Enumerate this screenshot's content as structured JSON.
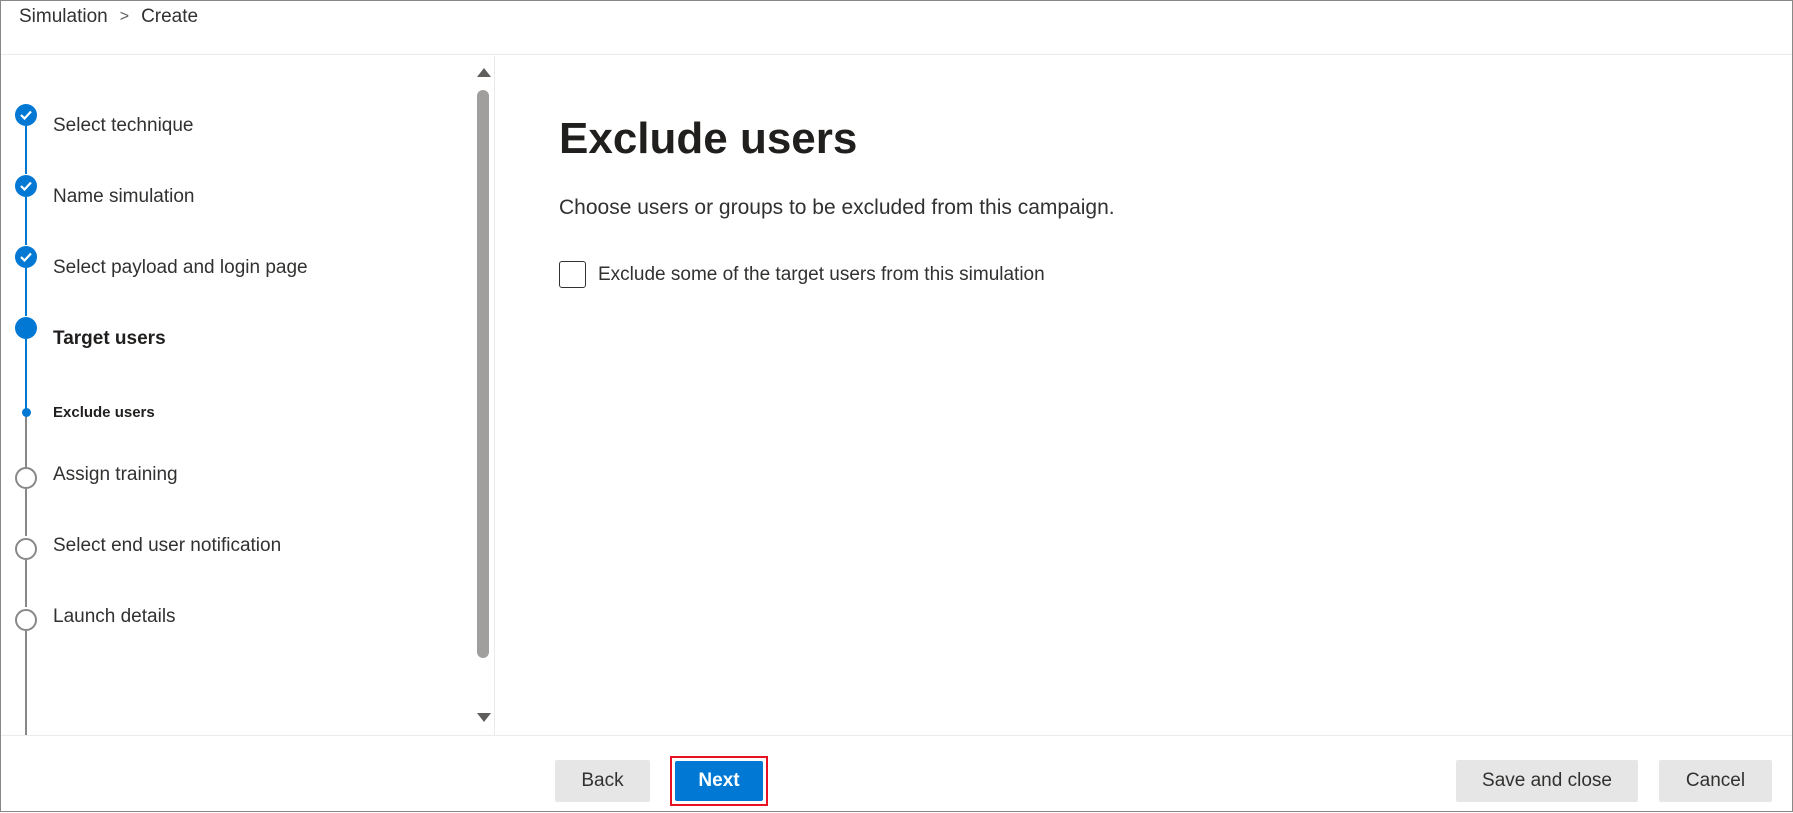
{
  "breadcrumb": {
    "items": [
      "Simulation",
      "Create"
    ],
    "separator": ">"
  },
  "steps": [
    {
      "label": "Select technique",
      "state": "done"
    },
    {
      "label": "Name simulation",
      "state": "done"
    },
    {
      "label": "Select payload and login page",
      "state": "done"
    },
    {
      "label": "Target users",
      "state": "current"
    },
    {
      "label": "Exclude users",
      "state": "sub-current"
    },
    {
      "label": "Assign training",
      "state": "todo"
    },
    {
      "label": "Select end user notification",
      "state": "todo"
    },
    {
      "label": "Launch details",
      "state": "todo"
    }
  ],
  "main": {
    "title": "Exclude users",
    "description": "Choose users or groups to be excluded from this campaign.",
    "checkbox_label": "Exclude some of the target users from this simulation",
    "checkbox_checked": false
  },
  "footer": {
    "back_label": "Back",
    "next_label": "Next",
    "save_label": "Save and close",
    "cancel_label": "Cancel"
  },
  "colors": {
    "accent": "#0078d4",
    "highlight_border": "#e81123"
  }
}
